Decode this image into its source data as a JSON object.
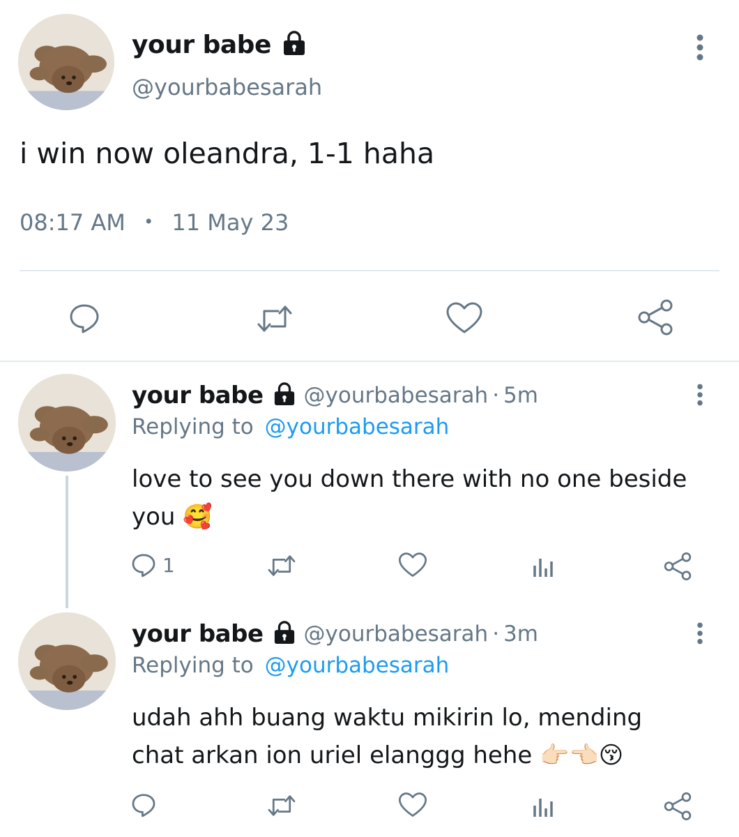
{
  "main_tweet": {
    "display_name": "your babe",
    "handle": "@yourbabesarah",
    "text": "i win now oleandra, 1-1 haha",
    "time": "08:17 AM",
    "separator": "•",
    "date": "11 May 23"
  },
  "replies": [
    {
      "display_name": "your babe",
      "handle": "@yourbabesarah",
      "age": "5m",
      "replying_prefix": "Replying to",
      "replying_to": "@yourbabesarah",
      "text_line1": "love to see you down there with no one beside",
      "text_line2": "you 🥰",
      "reply_count": "1"
    },
    {
      "display_name": "your babe",
      "handle": "@yourbabesarah",
      "age": "3m",
      "replying_prefix": "Replying to",
      "replying_to": "@yourbabesarah",
      "text_line1": "udah ahh buang waktu mikirin lo, mending",
      "text_line2": "chat arkan ion uriel elanggg hehe 👉🏻👈🏻😚",
      "reply_count": ""
    }
  ],
  "icons": {
    "lock": "lock-icon",
    "more": "more-vertical-icon",
    "reply": "reply-bubble-icon",
    "retweet": "retweet-icon",
    "like": "heart-icon",
    "share": "share-icon",
    "analytics": "analytics-bar-icon"
  },
  "colors": {
    "text": "#14171a",
    "muted": "#657786",
    "link": "#1d9bf0",
    "divider": "#e1e8ed"
  }
}
